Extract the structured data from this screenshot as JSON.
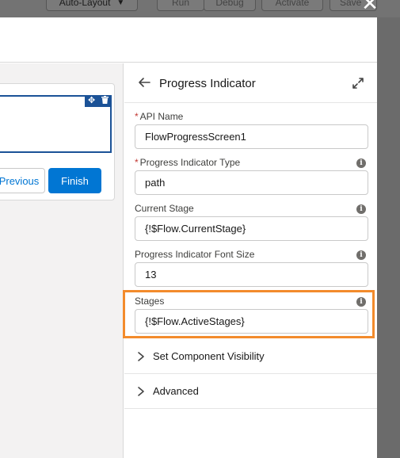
{
  "toolbar": {
    "layout_label": "Auto-Layout",
    "run_label": "Run",
    "debug_label": "Debug",
    "activate_label": "Activate",
    "save_label": "Save"
  },
  "canvas": {
    "previous_label": "Previous",
    "finish_label": "Finish"
  },
  "panel": {
    "title": "Progress Indicator",
    "fields": [
      {
        "label": "API Name",
        "required": true,
        "info": false,
        "value": "FlowProgressScreen1"
      },
      {
        "label": "Progress Indicator Type",
        "required": true,
        "info": true,
        "value": "path"
      },
      {
        "label": "Current Stage",
        "required": false,
        "info": true,
        "value": "{!$Flow.CurrentStage}"
      },
      {
        "label": "Progress Indicator Font Size",
        "required": false,
        "info": true,
        "value": "13"
      },
      {
        "label": "Stages",
        "required": false,
        "info": true,
        "value": "{!$Flow.ActiveStages}"
      }
    ],
    "sections": [
      {
        "label": "Set Component Visibility"
      },
      {
        "label": "Advanced"
      }
    ]
  },
  "colors": {
    "brand": "#0176d3",
    "highlight": "#f38b2c",
    "selection": "#1b5297",
    "required": "#c23934"
  }
}
